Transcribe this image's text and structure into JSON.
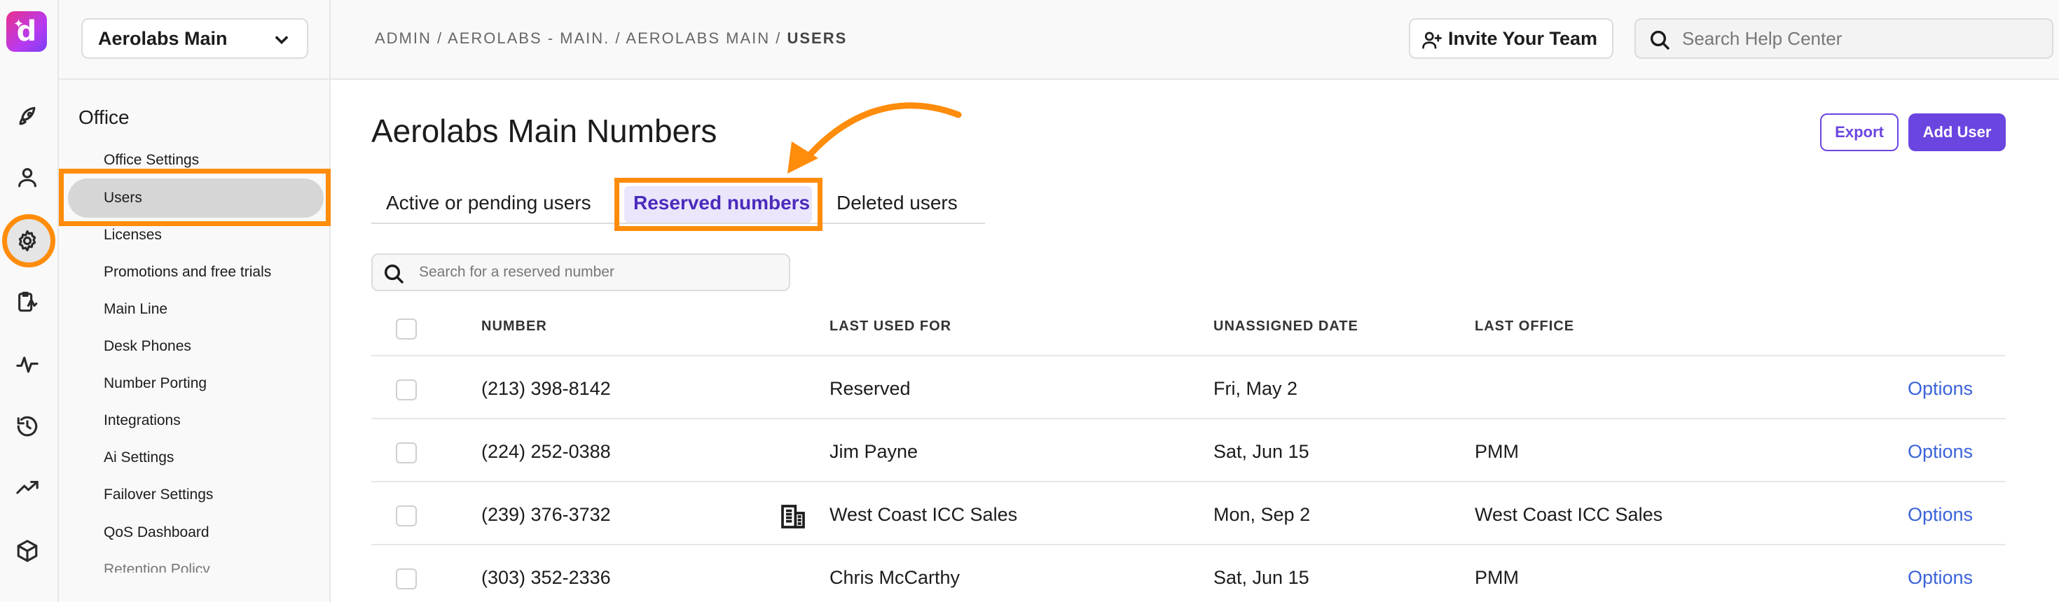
{
  "app": {
    "logo_letter": "d",
    "brand_color": "#7a3ef5",
    "accent_orange": "#ff8c0a",
    "link_color": "#3b63d9"
  },
  "rail": {
    "icons": [
      "rocket-icon",
      "person-icon",
      "gear-icon",
      "clipboard-icon",
      "activity-icon",
      "history-icon",
      "trending-icon",
      "cube-icon"
    ],
    "active": "gear-icon"
  },
  "sidebar": {
    "office_select": "Aerolabs Main",
    "heading": "Office",
    "items": [
      {
        "label": "Office Settings"
      },
      {
        "label": "Users"
      },
      {
        "label": "Licenses"
      },
      {
        "label": "Promotions and free trials"
      },
      {
        "label": "Main Line"
      },
      {
        "label": "Desk Phones"
      },
      {
        "label": "Number Porting"
      },
      {
        "label": "Integrations"
      },
      {
        "label": "Ai Settings"
      },
      {
        "label": "Failover Settings"
      },
      {
        "label": "QoS Dashboard"
      },
      {
        "label": "Retention Policy"
      }
    ],
    "active_item": "Users"
  },
  "topbar": {
    "breadcrumb": [
      "ADMIN",
      "AEROLABS - MAIN.",
      "AEROLABS MAIN",
      "USERS"
    ],
    "breadcrumb_sep": " / ",
    "invite_label": "Invite Your Team",
    "help_search_placeholder": "Search Help Center"
  },
  "main": {
    "title": "Aerolabs Main Numbers",
    "export_label": "Export",
    "add_user_label": "Add User",
    "tabs": [
      {
        "label": "Active or pending users"
      },
      {
        "label": "Reserved numbers"
      },
      {
        "label": "Deleted users"
      }
    ],
    "active_tab": "Reserved numbers",
    "search_placeholder": "Search for a reserved number",
    "table": {
      "columns": [
        "NUMBER",
        "LAST USED FOR",
        "UNASSIGNED DATE",
        "LAST OFFICE"
      ],
      "rows": [
        {
          "number": "(213) 398-8142",
          "last_used_for": "Reserved",
          "unassigned_date": "Fri, May 2",
          "last_office": "",
          "action": "Options"
        },
        {
          "number": "(224) 252-0388",
          "last_used_for": "Jim Payne",
          "unassigned_date": "Sat, Jun 15",
          "last_office": "PMM",
          "action": "Options"
        },
        {
          "number": "(239) 376-3732",
          "last_used_for": "West Coast ICC Sales",
          "unassigned_date": "Mon, Sep 2",
          "last_office": "West Coast ICC Sales",
          "action": "Options",
          "icon": "building-icon"
        },
        {
          "number": "(303) 352-2336",
          "last_used_for": "Chris McCarthy",
          "unassigned_date": "Sat, Jun 15",
          "last_office": "PMM",
          "action": "Options"
        }
      ]
    }
  }
}
